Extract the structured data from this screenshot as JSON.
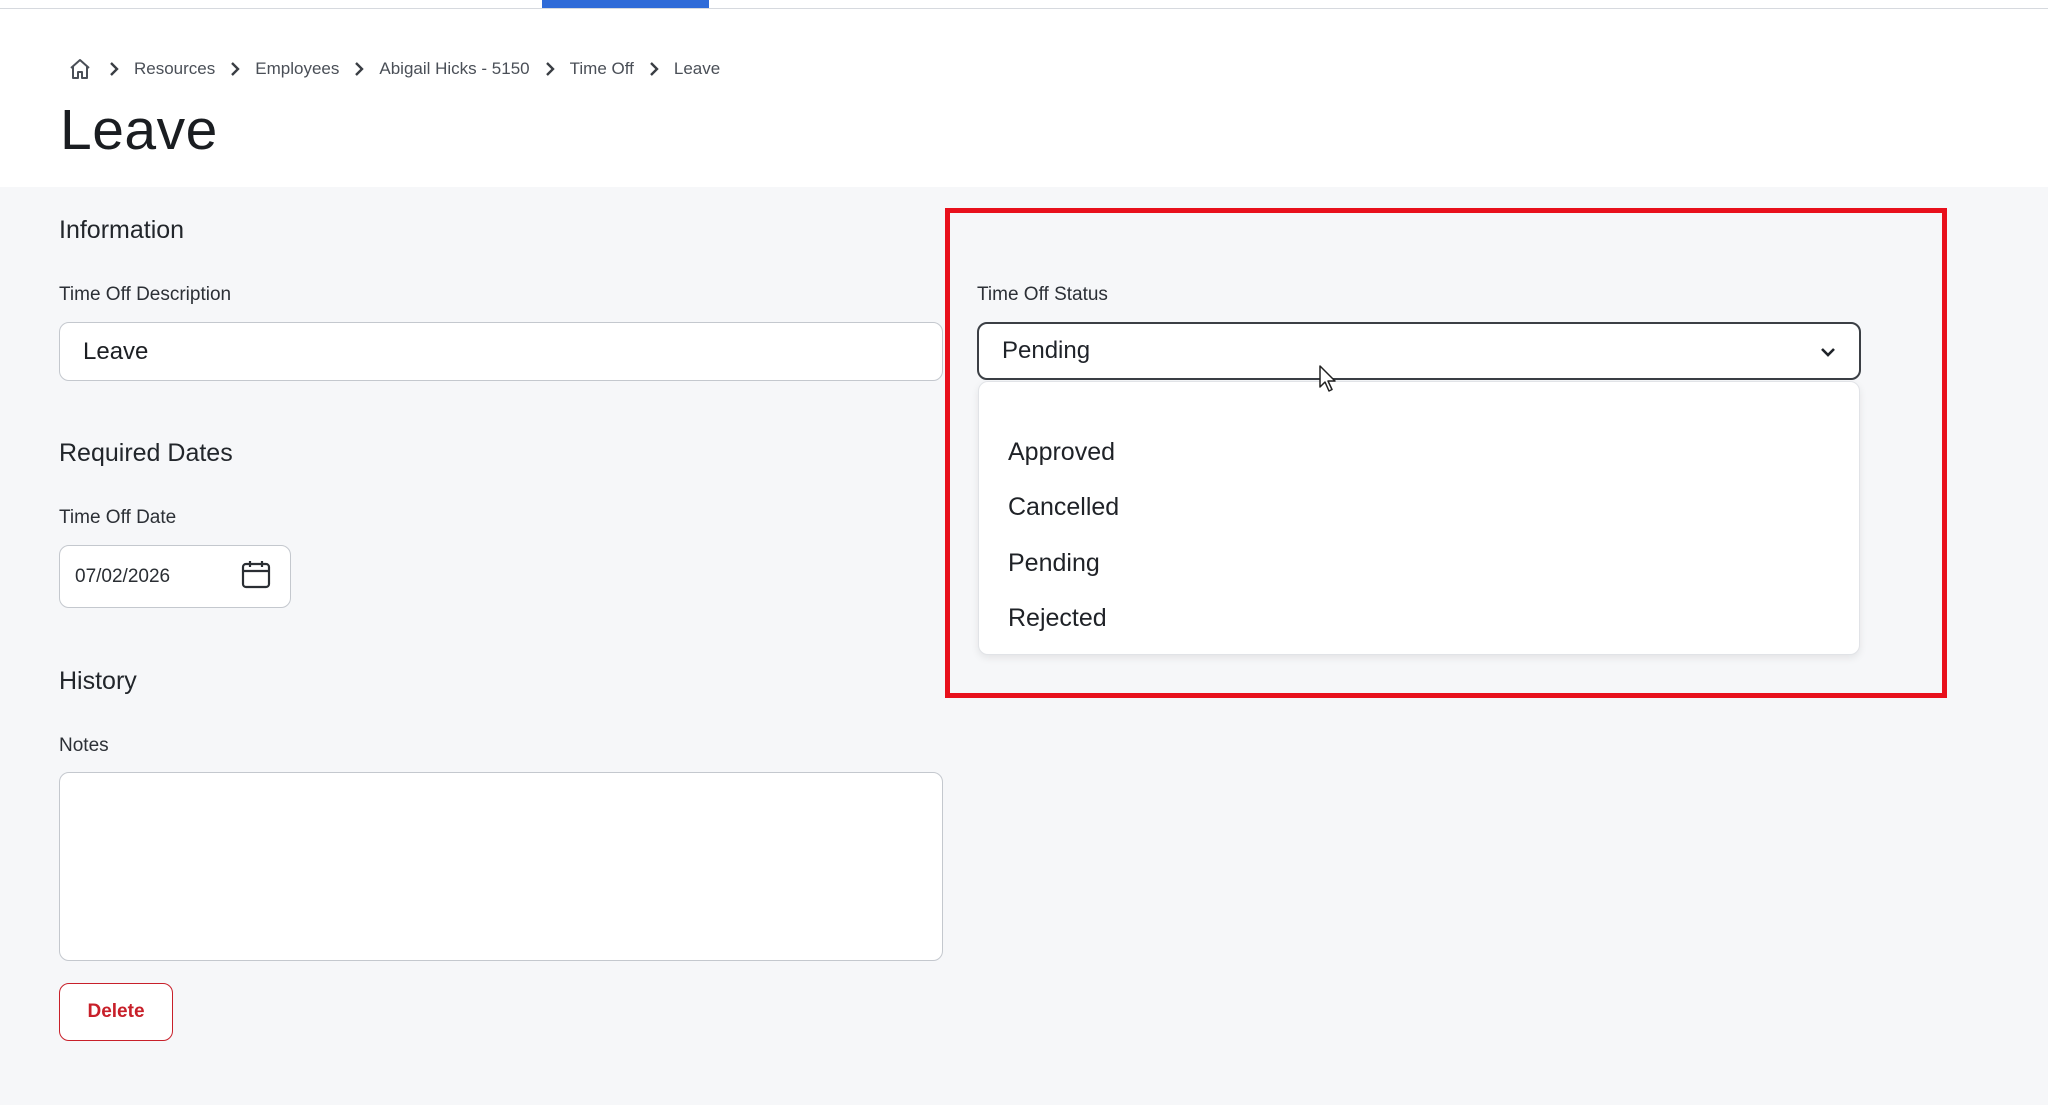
{
  "breadcrumb": {
    "items": [
      "Resources",
      "Employees",
      "Abigail Hicks - 5150",
      "Time Off",
      "Leave"
    ]
  },
  "page": {
    "title": "Leave"
  },
  "information": {
    "section_title": "Information",
    "description_label": "Time Off Description",
    "description_value": "Leave"
  },
  "required_dates": {
    "section_title": "Required Dates",
    "date_label": "Time Off Date",
    "date_value": "07/02/2026"
  },
  "history": {
    "section_title": "History",
    "notes_label": "Notes",
    "notes_value": ""
  },
  "actions": {
    "delete_label": "Delete"
  },
  "status": {
    "label": "Time Off Status",
    "selected": "Pending",
    "options": [
      "Approved",
      "Cancelled",
      "Pending",
      "Rejected"
    ]
  },
  "colors": {
    "accent": "#2f6bd8",
    "danger": "#c8202a",
    "highlight": "#e8101c",
    "background": "#f6f7f9"
  }
}
